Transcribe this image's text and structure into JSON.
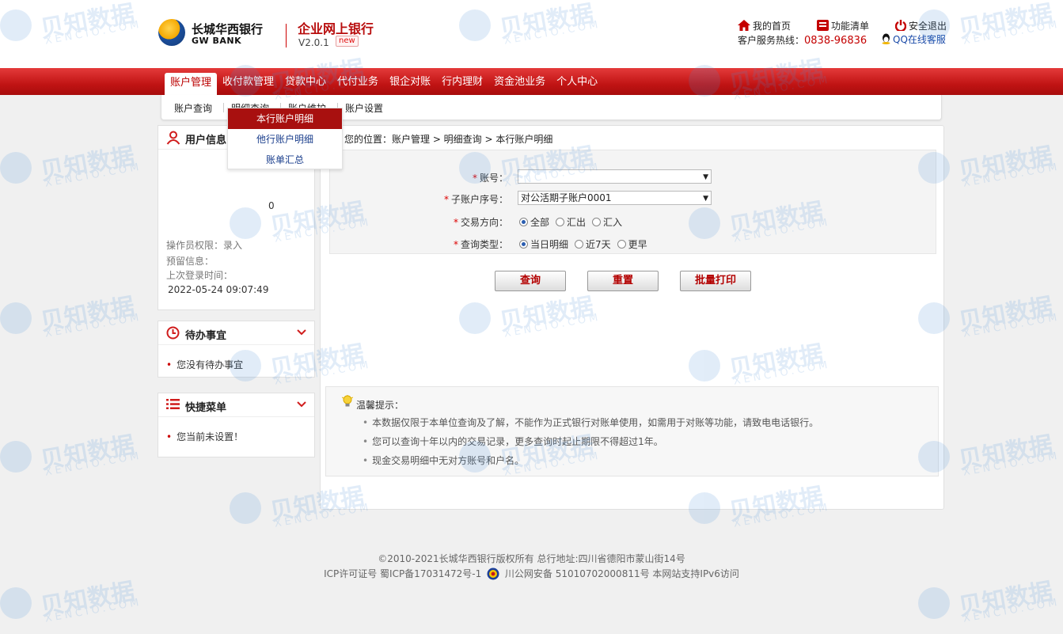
{
  "header": {
    "bank_name_cn": "长城华西银行",
    "bank_name_en": "GW BANK",
    "system_name": "企业网上银行",
    "version": "V2.0.1",
    "new_tag": "new",
    "links": {
      "home": "我的首页",
      "menu_list": "功能清单",
      "logout": "安全退出",
      "qq_service": "QQ在线客服"
    },
    "hotline_label": "客户服务热线：",
    "hotline_number": "0838-96836"
  },
  "nav": {
    "items": [
      "账户管理",
      "收付款管理",
      "贷款中心",
      "代付业务",
      "银企对账",
      "行内理财",
      "资金池业务",
      "个人中心"
    ]
  },
  "subnav": {
    "items": [
      "账户查询",
      "明细查询",
      "账户维护",
      "账户设置"
    ]
  },
  "dropdown": {
    "items": [
      "本行账户明细",
      "他行账户明细",
      "账单汇总"
    ]
  },
  "user_panel": {
    "title": "用户信息",
    "zero_value": "0",
    "permission_label": "操作员权限：",
    "permission_value": "录入",
    "reserved_label": "预留信息：",
    "last_login_label": "上次登录时间：",
    "last_login_value": "2022-05-24 09:07:49"
  },
  "todo_panel": {
    "title": "待办事宜",
    "empty_text": "您没有待办事宜"
  },
  "quick_panel": {
    "title": "快捷菜单",
    "empty_text": "您当前未设置！"
  },
  "breadcrumb": "您的位置：账户管理 > 明细查询 > 本行账户明细",
  "form": {
    "account_label": "账号：",
    "account_value": "",
    "sub_account_label": "子账户序号：",
    "sub_account_value": "对公活期子账户0001",
    "direction_label": "交易方向：",
    "direction_options": [
      "全部",
      "汇出",
      "汇入"
    ],
    "direction_selected": "全部",
    "query_type_label": "查询类型：",
    "query_type_options": [
      "当日明细",
      "近7天",
      "更早"
    ],
    "query_type_selected": "当日明细"
  },
  "buttons": {
    "query": "查询",
    "reset": "重置",
    "batch_print": "批量打印"
  },
  "tips": {
    "title": "温馨提示：",
    "lines": [
      "本数据仅限于本单位查询及了解，不能作为正式银行对账单使用，如需用于对账等功能，请致电电话银行。",
      "您可以查询十年以内的交易记录，更多查询时起止期限不得超过1年。",
      "现金交易明细中无对方账号和户名。"
    ]
  },
  "footer": {
    "line1": "©2010-2021长城华西银行版权所有 总行地址:四川省德阳市蒙山街14号",
    "icp_text": "ICP许可证号  蜀ICP备17031472号-1",
    "police_text": "川公网安备 51010702000811号 本网站支持IPv6访问"
  },
  "watermark": {
    "cn": "贝知数据",
    "en": "XENCIO.COM"
  },
  "colors": {
    "brand_red": "#c11414",
    "accent_blue": "#1a3e8c"
  }
}
